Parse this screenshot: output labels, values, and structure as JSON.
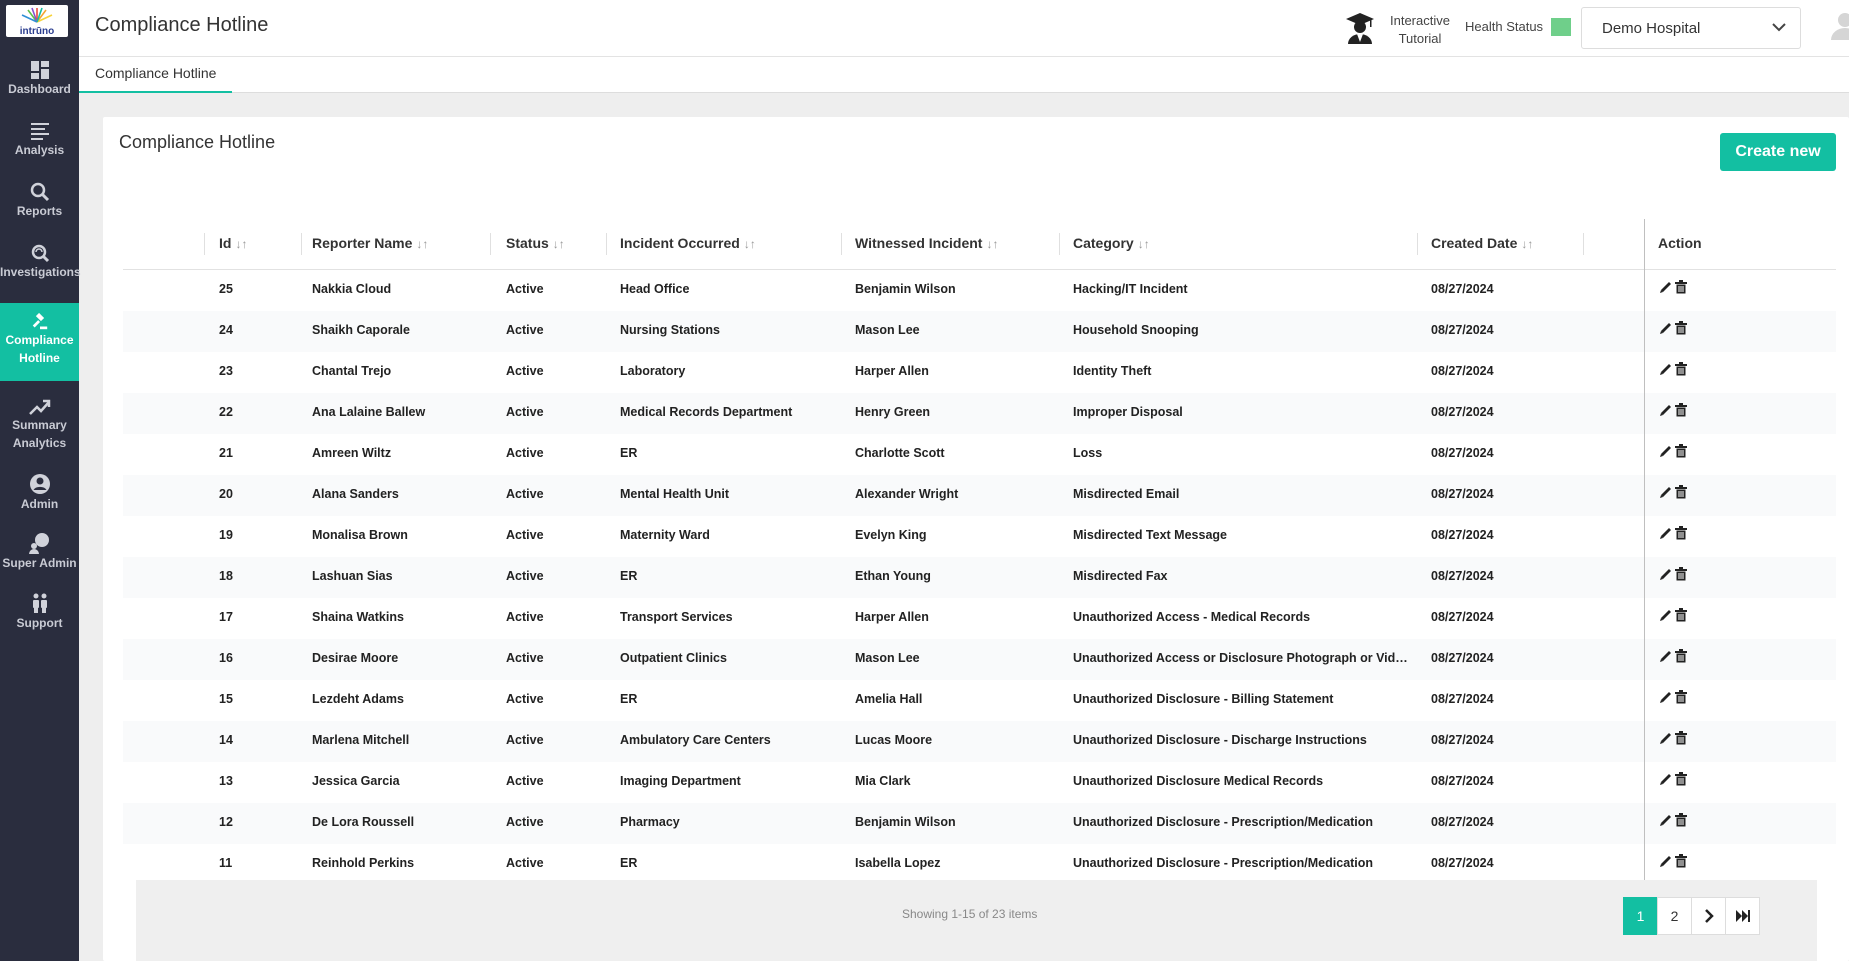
{
  "app": {
    "logo_text": "intrūno",
    "colors": {
      "accent": "#13bfa2",
      "sidebar_bg": "#2a2d3e",
      "health_ok": "#6fcf8a"
    }
  },
  "sidebar": {
    "items": [
      {
        "label": "Dashboard",
        "icon": "dashboard-icon"
      },
      {
        "label": "Analysis",
        "icon": "analysis-icon"
      },
      {
        "label": "Reports",
        "icon": "search-icon"
      },
      {
        "label": "Investigations",
        "icon": "investigations-icon"
      },
      {
        "label_1": "Compliance",
        "label_2": "Hotline",
        "icon": "gavel-icon",
        "active": true
      },
      {
        "label_1": "Summary",
        "label_2": "Analytics",
        "icon": "trend-icon"
      },
      {
        "label": "Admin",
        "icon": "user-circle-icon"
      },
      {
        "label": "Super Admin",
        "icon": "super-admin-icon"
      },
      {
        "label": "Support",
        "icon": "support-icon"
      }
    ]
  },
  "header": {
    "title": "Compliance Hotline",
    "tutorial_label_1": "Interactive",
    "tutorial_label_2": "Tutorial",
    "health_label": "Health Status",
    "hospital_selected": "Demo Hospital"
  },
  "tabs": [
    {
      "label": "Compliance Hotline",
      "active": true
    }
  ],
  "card": {
    "title": "Compliance Hotline",
    "create_label": "Create new"
  },
  "table": {
    "columns": [
      "Id",
      "Reporter Name",
      "Status",
      "Incident Occurred",
      "Witnessed Incident",
      "Category",
      "Created Date",
      "Action"
    ],
    "sort_glyph": "↓↑",
    "rows": [
      [
        "25",
        "Nakkia Cloud",
        "Active",
        "Head Office",
        "Benjamin Wilson",
        "Hacking/IT Incident",
        "08/27/2024"
      ],
      [
        "24",
        "Shaikh Caporale",
        "Active",
        "Nursing Stations",
        "Mason Lee",
        "Household Snooping",
        "08/27/2024"
      ],
      [
        "23",
        "Chantal Trejo",
        "Active",
        "Laboratory",
        "Harper Allen",
        "Identity Theft",
        "08/27/2024"
      ],
      [
        "22",
        "Ana Lalaine Ballew",
        "Active",
        "Medical Records Department",
        "Henry Green",
        "Improper Disposal",
        "08/27/2024"
      ],
      [
        "21",
        "Amreen Wiltz",
        "Active",
        "ER",
        "Charlotte Scott",
        "Loss",
        "08/27/2024"
      ],
      [
        "20",
        "Alana Sanders",
        "Active",
        "Mental Health Unit",
        "Alexander Wright",
        "Misdirected Email",
        "08/27/2024"
      ],
      [
        "19",
        "Monalisa Brown",
        "Active",
        "Maternity Ward",
        "Evelyn King",
        "Misdirected Text Message",
        "08/27/2024"
      ],
      [
        "18",
        "Lashuan Sias",
        "Active",
        "ER",
        "Ethan Young",
        "Misdirected Fax",
        "08/27/2024"
      ],
      [
        "17",
        "Shaina Watkins",
        "Active",
        "Transport Services",
        "Harper Allen",
        "Unauthorized Access - Medical Records",
        "08/27/2024"
      ],
      [
        "16",
        "Desirae Moore",
        "Active",
        "Outpatient Clinics",
        "Mason Lee",
        "Unauthorized Access or Disclosure Photograph or Video Recording",
        "08/27/2024"
      ],
      [
        "15",
        "Lezdeht Adams",
        "Active",
        "ER",
        "Amelia Hall",
        "Unauthorized Disclosure - Billing Statement",
        "08/27/2024"
      ],
      [
        "14",
        "Marlena Mitchell",
        "Active",
        "Ambulatory Care Centers",
        "Lucas Moore",
        "Unauthorized Disclosure - Discharge Instructions",
        "08/27/2024"
      ],
      [
        "13",
        "Jessica Garcia",
        "Active",
        "Imaging Department",
        "Mia Clark",
        "Unauthorized Disclosure Medical Records",
        "08/27/2024"
      ],
      [
        "12",
        "De Lora Roussell",
        "Active",
        "Pharmacy",
        "Benjamin Wilson",
        "Unauthorized Disclosure - Prescription/Medication",
        "08/27/2024"
      ],
      [
        "11",
        "Reinhold Perkins",
        "Active",
        "ER",
        "Isabella Lopez",
        "Unauthorized Disclosure - Prescription/Medication",
        "08/27/2024"
      ]
    ]
  },
  "pagination": {
    "info": "Showing 1-15 of 23 items",
    "pages": [
      "1",
      "2"
    ],
    "current": "1",
    "next_glyph": "❯",
    "last_glyph": "⏭"
  }
}
